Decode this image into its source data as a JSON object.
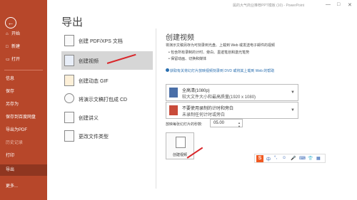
{
  "window": {
    "title": "属的大气商业推荐PPT模板 (10) - PowerPoint"
  },
  "page": {
    "title": "导出"
  },
  "sidebar": {
    "items": [
      {
        "label": "开始",
        "icon": "home-icon"
      },
      {
        "label": "新建",
        "icon": "new-icon"
      },
      {
        "label": "打开",
        "icon": "folder-icon"
      },
      {
        "label": "信息",
        "icon": ""
      },
      {
        "label": "保存",
        "icon": ""
      },
      {
        "label": "另存为",
        "icon": ""
      },
      {
        "label": "保存到百度网盘",
        "icon": ""
      },
      {
        "label": "导出为PDF",
        "icon": ""
      },
      {
        "label": "历史记录",
        "icon": ""
      },
      {
        "label": "打印",
        "icon": ""
      },
      {
        "label": "导出",
        "icon": ""
      },
      {
        "label": "更多...",
        "icon": ""
      }
    ]
  },
  "export_menu": [
    {
      "label": "创建 PDF/XPS 文档"
    },
    {
      "label": "创建视频"
    },
    {
      "label": "创建动态 GIF"
    },
    {
      "label": "将演示文稿打包成 CD"
    },
    {
      "label": "创建讲义"
    },
    {
      "label": "更改文件类型"
    }
  ],
  "video": {
    "heading": "创建视频",
    "description": "将演示文稿另存为可刻录到光盘、上载到 Web 或发送电子邮件的视频",
    "bullets": [
      "包含所有录制的计时、旁白、墨迹笔划和激光笔势",
      "保留动画、切换和媒体"
    ],
    "link": "获取有关将幻灯片放映视频刻录到 DVD 或将其上载到 Web 的帮助",
    "quality": {
      "title": "全高清(1080p)",
      "subtitle": "较大文件大小和最高质量(1920 x 1080)"
    },
    "narration": {
      "title": "不要使用录制的计时和旁白",
      "subtitle": "未录制任何计时或旁白"
    },
    "seconds_label": "放映每张幻灯片的秒数:",
    "seconds_value": "05.00",
    "create_button": "创建视频"
  },
  "ime": {
    "logo": "S",
    "items": [
      "中",
      "°,",
      "☺",
      "🎤",
      "⌨",
      "👕",
      "▦"
    ]
  },
  "colors": {
    "accent": "#b7472a",
    "arrow": "#d9262a",
    "link": "#2a6fb0"
  }
}
